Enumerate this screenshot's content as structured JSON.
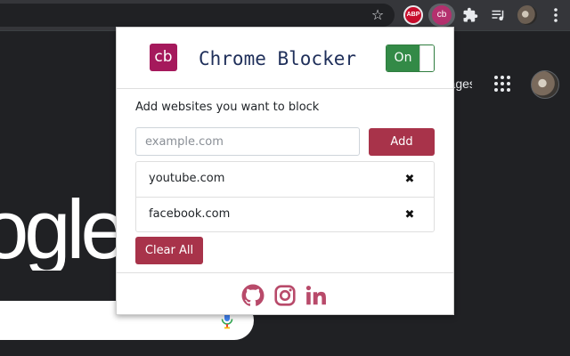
{
  "browser": {
    "extensions": {
      "abp_label": "ABP",
      "cb_label": "cb"
    },
    "icons": [
      "star-icon",
      "puzzle-icon",
      "media-control-icon",
      "kebab-menu-icon"
    ]
  },
  "google_page": {
    "images_link": "Images",
    "logo_fragment": "ogle"
  },
  "popup": {
    "logo_label": "cb",
    "title": "Chrome Blocker",
    "toggle_label": "On",
    "toggle_state": "on",
    "prompt": "Add websites you want to block",
    "input": {
      "placeholder": "example.com",
      "value": ""
    },
    "add_label": "Add",
    "blocked_sites": [
      {
        "name": "youtube.com",
        "remove": "✖"
      },
      {
        "name": "facebook.com",
        "remove": "✖"
      }
    ],
    "clear_label": "Clear All",
    "social_icons": [
      "github-icon",
      "instagram-icon",
      "linkedin-icon"
    ]
  },
  "colors": {
    "accent": "#a8334a",
    "logo": "#a5195c",
    "title": "#1f2f5a",
    "toggle": "#338a47",
    "social": "#b84a6a"
  }
}
